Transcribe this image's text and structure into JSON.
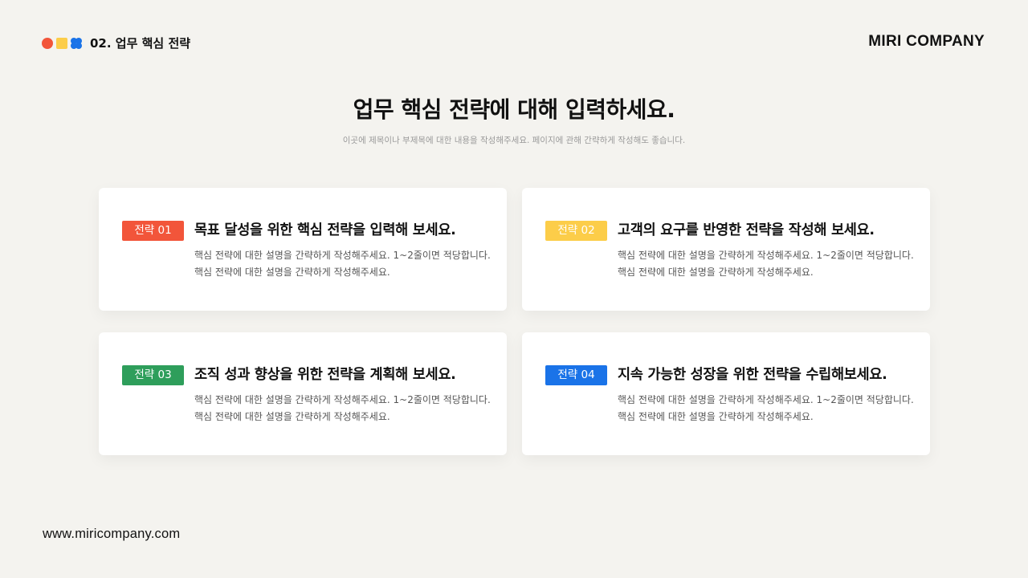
{
  "header": {
    "section_label": "02. 업무 핵심 전략",
    "brand": "MIRI COMPANY",
    "dot_colors": {
      "red": "#f2553a",
      "yellow": "#fccd49",
      "blue": "#1a73e8"
    }
  },
  "main": {
    "title": "업무 핵심 전략에 대해 입력하세요.",
    "subtitle": "이곳에 제목이나 부제목에 대한 내용을 작성해주세요.  페이지에 관해 간략하게 작성해도 좋습니다."
  },
  "cards": [
    {
      "badge": "전략 01",
      "badge_color": "#f2553a",
      "title": "목표 달성을 위한 핵심 전략을 입력해 보세요.",
      "desc": "핵심 전략에 대한 설명을 간략하게 작성해주세요.  1~2줄이면 적당합니다. 핵심 전략에 대한 설명을 간략하게 작성해주세요."
    },
    {
      "badge": "전략 02",
      "badge_color": "#fccd49",
      "title": "고객의 요구를 반영한 전략을 작성해 보세요.",
      "desc": "핵심 전략에 대한 설명을 간략하게 작성해주세요.  1~2줄이면 적당합니다. 핵심 전략에 대한 설명을 간략하게 작성해주세요."
    },
    {
      "badge": "전략 03",
      "badge_color": "#2e9e5b",
      "title": "조직 성과 향상을 위한 전략을 계획해 보세요.",
      "desc": "핵심 전략에 대한 설명을 간략하게 작성해주세요.  1~2줄이면 적당합니다. 핵심 전략에 대한 설명을 간략하게 작성해주세요."
    },
    {
      "badge": "전략 04",
      "badge_color": "#1a73e8",
      "title": "지속 가능한 성장을 위한 전략을 수립해보세요.",
      "desc": "핵심 전략에 대한 설명을 간략하게 작성해주세요.  1~2줄이면 적당합니다. 핵심 전략에 대한 설명을 간략하게 작성해주세요."
    }
  ],
  "footer": {
    "url": "www.miricompany.com"
  }
}
